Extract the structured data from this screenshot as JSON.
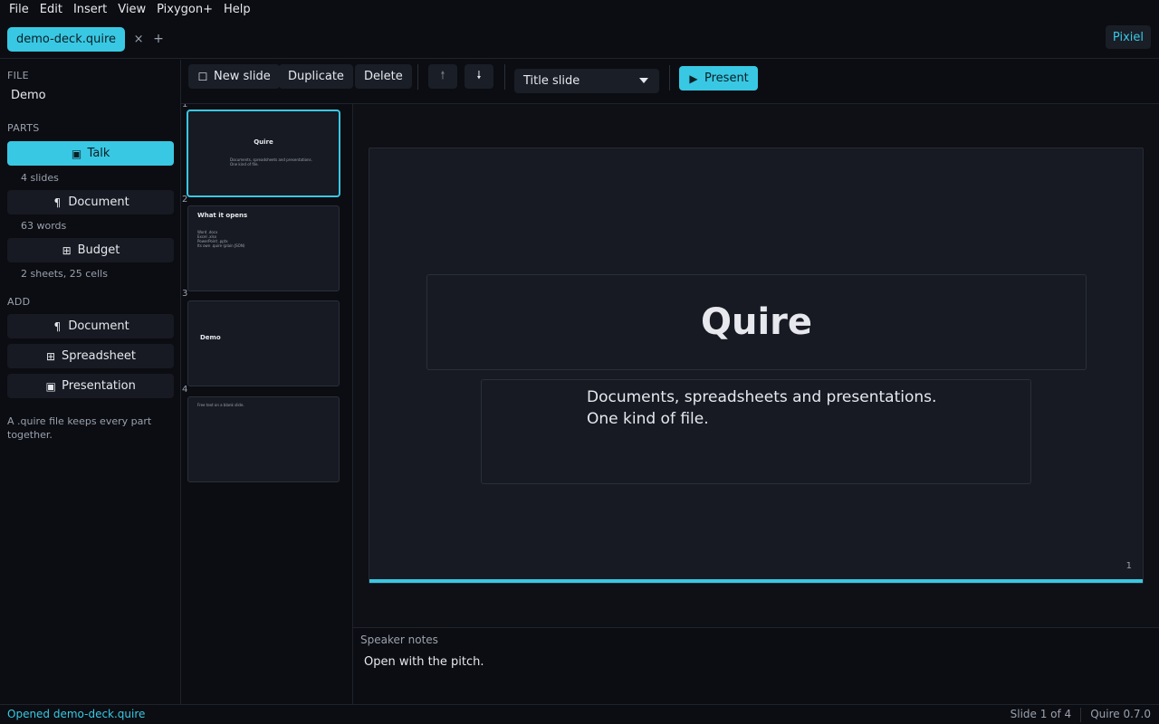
{
  "menu": [
    "File",
    "Edit",
    "Insert",
    "View",
    "Pixygon+",
    "Help"
  ],
  "tabs": {
    "active_label": "demo-deck.quire",
    "close_glyph": "×",
    "add_glyph": "+"
  },
  "account": {
    "label": "Pixiel"
  },
  "sidebar": {
    "file_label": "FILE",
    "file_name": "Demo",
    "parts_label": "PARTS",
    "parts": [
      {
        "label": "Talk",
        "meta": "4 slides",
        "icon": "presentation-icon",
        "active": true
      },
      {
        "label": "Document",
        "meta": "63 words",
        "icon": "paragraph-icon",
        "active": false
      },
      {
        "label": "Budget",
        "meta": "2 sheets, 25 cells",
        "icon": "spreadsheet-icon",
        "active": false
      }
    ],
    "add_label": "ADD",
    "add_items": [
      {
        "label": "Document",
        "icon": "paragraph-icon"
      },
      {
        "label": "Spreadsheet",
        "icon": "spreadsheet-icon"
      },
      {
        "label": "Presentation",
        "icon": "presentation-icon"
      }
    ],
    "hint": "A .quire file keeps every part together."
  },
  "toolbar": {
    "new_slide": "New slide",
    "duplicate": "Duplicate",
    "delete": "Delete",
    "layout_value": "Title slide",
    "present": "Present"
  },
  "thumbnails": [
    {
      "number": "1",
      "title": "Quire",
      "body": "Documents, spreadsheets and presentations.\nOne kind of file."
    },
    {
      "number": "2",
      "title": "What it opens",
      "body": "Word .docx\nExcel .xlsx\nPowerPoint .pptx\nIts own .quire (plain JSON)"
    },
    {
      "number": "3",
      "title": "Demo",
      "body": ""
    },
    {
      "number": "4",
      "title": "",
      "body": "Free text on a blank slide."
    }
  ],
  "slide": {
    "title": "Quire",
    "body_line1": "Documents, spreadsheets and presentations.",
    "body_line2": "One kind of file.",
    "number": "1"
  },
  "notes": {
    "label": "Speaker notes",
    "text": "Open with the pitch."
  },
  "status": {
    "left": "Opened demo-deck.quire",
    "slide_pos": "Slide 1 of 4",
    "version": "Quire 0.7.0"
  },
  "colors": {
    "accent": "#39c8e3",
    "background": "#0b0d12",
    "surface": "#171a22"
  }
}
